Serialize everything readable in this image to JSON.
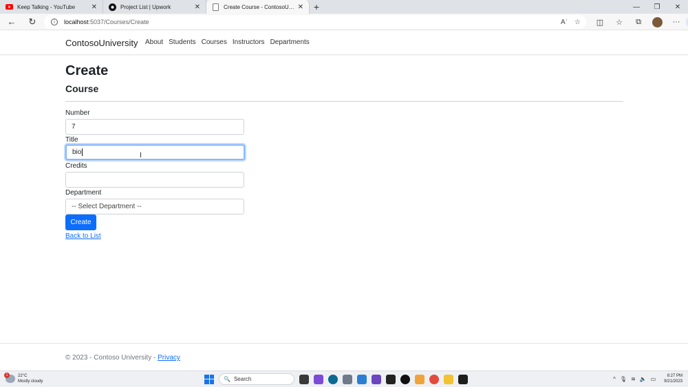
{
  "browser": {
    "tabs": [
      {
        "label": "Keep Talking - YouTube",
        "icon": "youtube-icon",
        "active": false
      },
      {
        "label": "Project List | Upwork",
        "icon": "upwork-icon",
        "active": false
      },
      {
        "label": "Create Course - ContosoUniversi",
        "icon": "page-icon",
        "active": true
      }
    ],
    "close_glyph": "✕",
    "new_tab_glyph": "+",
    "window_controls": {
      "minimize": "—",
      "restore": "❐",
      "close": "✕"
    },
    "back_glyph": "←",
    "reload_glyph": "↻",
    "info_glyph": "i",
    "url_host": "localhost",
    "url_path": ":5037/Courses/Create",
    "omnibox_right": {
      "read_aloud": "Aʾ",
      "favorite": "☆"
    },
    "toolbar_right": {
      "split": "◫",
      "favorites": "☆",
      "collections": "⧉",
      "more": "···",
      "copilot": "b"
    }
  },
  "site": {
    "brand": "ContosoUniversity",
    "nav": [
      "About",
      "Students",
      "Courses",
      "Instructors",
      "Departments"
    ]
  },
  "page": {
    "title": "Create",
    "subtitle": "Course",
    "form": {
      "number_label": "Number",
      "number_value": "7",
      "title_label": "Title",
      "title_value": "bio",
      "credits_label": "Credits",
      "credits_value": "",
      "department_label": "Department",
      "department_value": "-- Select Department --",
      "submit_label": "Create"
    },
    "back_link": "Back to List"
  },
  "footer": {
    "text": "© 2023 - Contoso University - ",
    "privacy_link": "Privacy"
  },
  "taskbar": {
    "weather_temp": "22°C",
    "weather_desc": "Mostly cloudy",
    "weather_badge": "1",
    "search_label": "Search",
    "search_glyph": "🔍",
    "time": "8:27 PM",
    "date": "9/21/2023",
    "tray_chevron": "^",
    "app_colors": [
      "#3a3a3a",
      "#7e4bd6",
      "#0b6a8f",
      "#6e7b8b",
      "#2a7fd4",
      "#6b46c1",
      "#222222",
      "#111111",
      "#f0a33a",
      "#e34b3c",
      "#f2c230",
      "#1e1e1e"
    ]
  },
  "colors": {
    "accent": "#0d6efd",
    "focus_ring": "#86b7fe",
    "youtube_red": "#ff0000"
  }
}
